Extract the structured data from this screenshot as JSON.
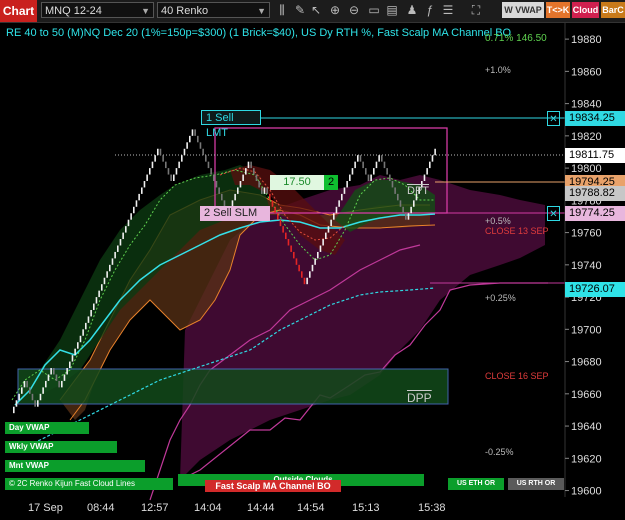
{
  "toolbar": {
    "title": "Chart",
    "instrument": "MNQ 12-24",
    "bar_type": "40 Renko",
    "buttons": [
      {
        "label": "W VWAP",
        "color": "#d9d9d9",
        "text": "#333"
      },
      {
        "label": "T<>K",
        "color": "#e3742b",
        "text": "#fff"
      },
      {
        "label": "Cloud",
        "color": "#d0204f",
        "text": "#fff"
      },
      {
        "label": "BarC",
        "color": "#c87a1a",
        "text": "#fff"
      }
    ],
    "icons": [
      "bar-type-icon",
      "drawing-tools-icon",
      "cursor-icon",
      "zoom-in-icon",
      "zoom-out-icon",
      "data-box-icon",
      "template-icon",
      "strategy-icon",
      "indicator-icon",
      "chart-properties-icon",
      "attach-order-icon"
    ]
  },
  "chart_header": "RE 40 to 50 (M)NQ Dec 20 (1%=150p=$300) (1 Brick=$40), US Dy RTH %, Fast Scalp MA Channel BO",
  "top_right_overlay": "0.71% 146.50",
  "percent_labels": [
    {
      "text": "+1.0%",
      "color": "#bbbbbb"
    },
    {
      "text": "+0.5%",
      "color": "#bbbbbb"
    },
    {
      "text": "CLOSE 13 SEP",
      "color": "#e03c3c"
    },
    {
      "text": "+0.25%",
      "color": "#bbbbbb"
    },
    {
      "text": "CLOSE 16 SEP",
      "color": "#e03c3c"
    },
    {
      "text": "-0.25%",
      "color": "#bbbbbb"
    }
  ],
  "orders": {
    "sell_lmt": {
      "label": "1 Sell LMT",
      "price": "19834.25"
    },
    "sell_slm": {
      "label": "2 Sell SLM",
      "price": "19774.25"
    }
  },
  "position": {
    "pnl": "17.50",
    "qty": "2"
  },
  "price_tags": [
    {
      "value": "19811.75",
      "bg": "#ffffff",
      "fg": "#000000"
    },
    {
      "value": "19794.25",
      "bg": "#e9a26a",
      "fg": "#000000"
    },
    {
      "value": "19788.82",
      "bg": "#c7c7c7",
      "fg": "#000000"
    },
    {
      "value": "19726.07",
      "bg": "#2fe3e8",
      "fg": "#000000"
    }
  ],
  "chart_labels": {
    "dpt": "DPT",
    "dpp": "DPP"
  },
  "left_panels": [
    "Day VWAP",
    "Wkly VWAP",
    "Mnt VWAP"
  ],
  "bottom_bar": {
    "left_text": "© 2C Renko Kijun Fast Cloud Lines",
    "center_text": "Fast Scalp MA Channel BO",
    "right_top": "Outside Clouds",
    "us_eth": "US ETH OR",
    "us_rth": "US RTH OR"
  },
  "chart_data": {
    "type": "renko",
    "y_axis": {
      "ticks": [
        19880,
        19860,
        19840,
        19820,
        19800,
        19780,
        19760,
        19740,
        19720,
        19700,
        19680,
        19660,
        19640,
        19620,
        19600
      ],
      "ylim": [
        19596,
        19890
      ]
    },
    "x_axis": {
      "ticks": [
        "17 Sep",
        "08:44",
        "12:57",
        "14:04",
        "14:44",
        "14:54",
        "15:13",
        "15:38"
      ]
    },
    "bricks": {
      "closes": [
        19652,
        19656,
        19660,
        19664,
        19668,
        19664,
        19660,
        19656,
        19652,
        19656,
        19660,
        19664,
        19668,
        19672,
        19676,
        19672,
        19668,
        19664,
        19668,
        19672,
        19676,
        19680,
        19684,
        19688,
        19692,
        19696,
        19700,
        19704,
        19708,
        19712,
        19716,
        19720,
        19724,
        19728,
        19732,
        19736,
        19740,
        19744,
        19748,
        19752,
        19756,
        19760,
        19764,
        19768,
        19772,
        19776,
        19780,
        19784,
        19788,
        19792,
        19796,
        19800,
        19804,
        19808,
        19812,
        19808,
        19804,
        19800,
        19796,
        19792,
        19796,
        19800,
        19804,
        19808,
        19812,
        19816,
        19820,
        19824,
        19820,
        19816,
        19812,
        19808,
        19804,
        19800,
        19796,
        19792,
        19788,
        19784,
        19780,
        19776,
        19772,
        19776,
        19780,
        19784,
        19788,
        19792,
        19796,
        19800,
        19804,
        19800,
        19796,
        19792,
        19788,
        19784,
        19788,
        19784,
        19780,
        19776,
        19772,
        19768,
        19764,
        19760,
        19756,
        19752,
        19748,
        19744,
        19740,
        19736,
        19732,
        19728,
        19732,
        19736,
        19740,
        19744,
        19748,
        19752,
        19756,
        19760,
        19764,
        19768,
        19772,
        19776,
        19780,
        19784,
        19788,
        19792,
        19796,
        19800,
        19804,
        19808,
        19804,
        19800,
        19796,
        19792,
        19796,
        19800,
        19804,
        19808,
        19804,
        19800,
        19796,
        19792,
        19788,
        19784,
        19780,
        19776,
        19772,
        19768,
        19772,
        19776,
        19780,
        19784,
        19788,
        19792,
        19796,
        19800,
        19804,
        19808,
        19812
      ]
    }
  }
}
